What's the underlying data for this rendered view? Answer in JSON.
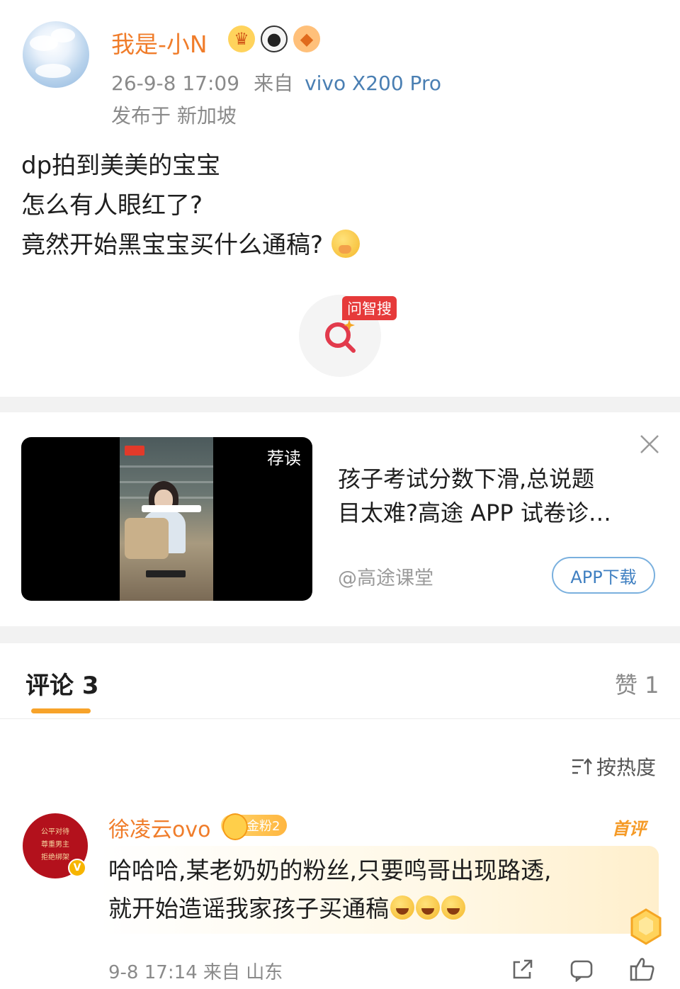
{
  "post": {
    "username": "我是-小N",
    "badges": [
      "crown-icon",
      "panda-icon",
      "fish-icon"
    ],
    "timestamp": "26-9-8 17:09",
    "from_label": "来自",
    "device": "vivo X200 Pro",
    "location": "发布于 新加坡",
    "body_lines": [
      "dp拍到美美的宝宝",
      "怎么有人眼红了?",
      "竟然开始黑宝宝买什么通稿?"
    ],
    "search_tag": "问智搜"
  },
  "ad": {
    "recommend_label": "荐读",
    "title_line1": "孩子考试分数下滑,总说题",
    "title_line2": "目太难?高途 APP 试卷诊…",
    "source": "@高途课堂",
    "download_label": "APP下载"
  },
  "comments_section": {
    "tab_label": "评论 3",
    "likes_label": "赞 1",
    "sort_label": "按热度",
    "colors": {
      "accent": "#f7a32a",
      "username": "#f07d2b"
    }
  },
  "comment": {
    "username": "徐凌云ovo",
    "fan_badge": "金粉2",
    "first_label": "首评",
    "avatar_seal": [
      "公平对待",
      "尊重男主",
      "拒绝绑架"
    ],
    "text_line1": "哈哈哈,某老奶奶的粉丝,只要鸣哥出现路透,",
    "text_line2": "就开始造谣我家孩子买通稿",
    "emojis": [
      "laugh-icon",
      "laugh-icon",
      "laugh-icon"
    ],
    "meta": "9-8 17:14 来自 山东"
  }
}
